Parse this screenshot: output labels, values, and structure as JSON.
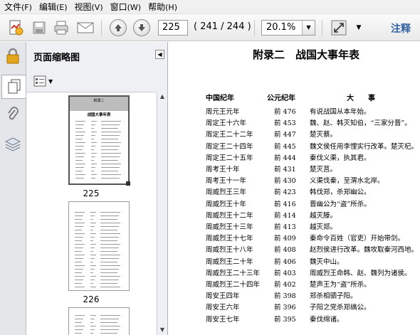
{
  "menu": [
    {
      "label": "文件",
      "key": "(F)"
    },
    {
      "label": "编辑",
      "key": "(E)"
    },
    {
      "label": "视图",
      "key": "(V)"
    },
    {
      "label": "窗口",
      "key": "(W)"
    },
    {
      "label": "帮助",
      "key": "(H)"
    }
  ],
  "toolbar": {
    "current_page": "225",
    "page_count": "( 241 / 244 )",
    "zoom": "20.1%",
    "comment_label": "注释"
  },
  "panel": {
    "title": "页面缩略图",
    "thumbnails": [
      {
        "page_label": "225",
        "header_small": "附录二",
        "title_small": "战国大事年表"
      },
      {
        "page_label": "226"
      }
    ]
  },
  "document": {
    "title": "附录二　战国大事年表",
    "headers": [
      "中国纪年",
      "公元纪年",
      "大　　事"
    ],
    "rows": [
      [
        "周元王元年",
        "前 476",
        "有说战国从本年始。"
      ],
      [
        "周定王十六年",
        "前 453",
        "魏、赵、韩灭知伯，“三家分晋”。"
      ],
      [
        "周定王二十二年",
        "前 447",
        "楚灭蔡。"
      ],
      [
        "周定王二十四年",
        "前 445",
        "魏文侯任用李悝实行改革。楚灭杞。"
      ],
      [
        "周定王二十五年",
        "前 444",
        "秦伐义渠，执其君。"
      ],
      [
        "周考王十年",
        "前 431",
        "楚灭莒。"
      ],
      [
        "周考王十一年",
        "前 430",
        "义渠伐秦，至渭水北岸。"
      ],
      [
        "周威烈王三年",
        "前 423",
        "韩伐郑，杀郑幽公。"
      ],
      [
        "周威烈王十年",
        "前 416",
        "晋幽公为“盗”所杀。"
      ],
      [
        "周威烈王十二年",
        "前 414",
        "越灭滕。"
      ],
      [
        "周威烈王十三年",
        "前 413",
        "越灭郯。"
      ],
      [
        "周威烈王十七年",
        "前 409",
        "秦命令百姓（官吏）开始带剑。"
      ],
      [
        "周威烈王十八年",
        "前 408",
        "赵烈侯进行改革。魏攻取秦河西地。"
      ],
      [
        "周威烈王二十年",
        "前 406",
        "魏灭中山。"
      ],
      [
        "周威烈王二十三年",
        "前 403",
        "周威烈王命韩、赵、魏列为诸侯。"
      ],
      [
        "周威烈王二十四年",
        "前 402",
        "楚声王为“盗”所杀。"
      ],
      [
        "周安王四年",
        "前 398",
        "郑杀相驷子阳。"
      ],
      [
        "周安王六年",
        "前 396",
        "子阳之党杀郑缟公。"
      ],
      [
        "周安王七年",
        "前 395",
        "秦伐绵诸。"
      ]
    ]
  }
}
